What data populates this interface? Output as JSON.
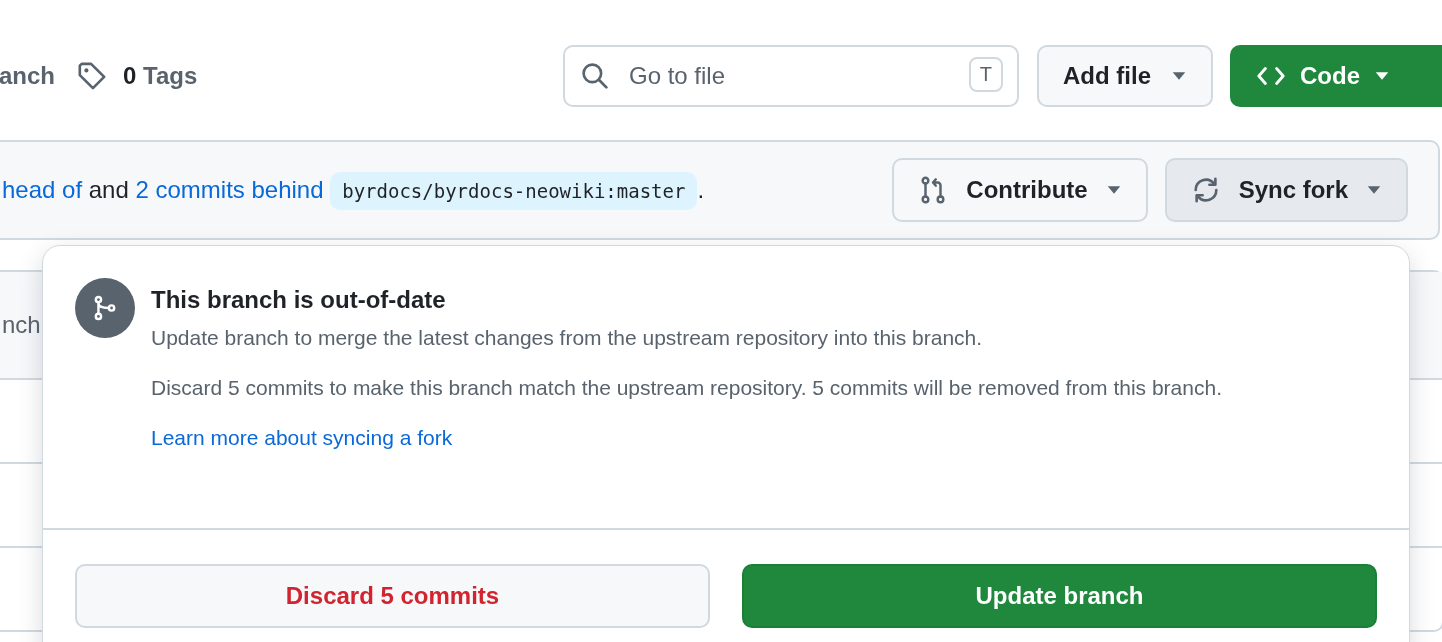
{
  "toolbar": {
    "branch_text": "anch",
    "tags": {
      "count": "0",
      "label": "Tags"
    },
    "search": {
      "placeholder": "Go to file",
      "shortcut": "T"
    },
    "buttons": [
      {
        "label": "Add file",
        "kind": "default"
      },
      {
        "label": "Code",
        "kind": "primary"
      }
    ]
  },
  "fork_banner": {
    "parts": [
      {
        "text": "head of",
        "kind": "link"
      },
      {
        "text": "and",
        "kind": "plain"
      },
      {
        "text": "2 commits behind",
        "kind": "link"
      }
    ],
    "branch_ref": "byrdocs/byrdocs-neowiki:master",
    "period": ".",
    "buttons": [
      {
        "label": "Contribute",
        "kind": "contribute",
        "expanded": false
      },
      {
        "label": "Sync fork",
        "kind": "sync",
        "expanded": true
      }
    ]
  },
  "file_list": {
    "visible_text": "nch"
  },
  "sync_popover": {
    "title": "This branch is out-of-date",
    "paragraphs": [
      "Update branch to merge the latest changes from the upstream repository into this branch.",
      "Discard 5 commits to make this branch match the upstream repository. 5 commits will be removed from this branch."
    ],
    "link": "Learn more about syncing a fork",
    "buttons": [
      {
        "label": "Discard 5 commits",
        "kind": "danger"
      },
      {
        "label": "Update branch",
        "kind": "primary"
      }
    ]
  }
}
